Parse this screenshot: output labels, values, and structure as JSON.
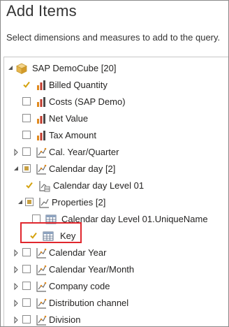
{
  "header": {
    "title": "Add Items",
    "subtitle": "Select dimensions and measures to add to the query."
  },
  "tree": {
    "root": {
      "label": "SAP DemoCube [20]"
    },
    "measures": [
      {
        "label": "Billed Quantity",
        "checked": true
      },
      {
        "label": "Costs (SAP Demo)",
        "checked": false
      },
      {
        "label": "Net Value",
        "checked": false
      },
      {
        "label": "Tax Amount",
        "checked": false
      }
    ],
    "dim_cal_year_quarter": {
      "label": "Cal. Year/Quarter"
    },
    "dim_calendar_day": {
      "label": "Calendar day [2]"
    },
    "level_calendar_day_01": {
      "label": "Calendar day Level 01"
    },
    "properties": {
      "label": "Properties [2]"
    },
    "prop_unique_name": {
      "label": "Calendar day Level 01.UniqueName"
    },
    "prop_key": {
      "label": "Key"
    },
    "dim_calendar_year": {
      "label": "Calendar Year"
    },
    "dim_calendar_year_month": {
      "label": "Calendar Year/Month"
    },
    "dim_company_code": {
      "label": "Company code"
    },
    "dim_distribution_channel": {
      "label": "Distribution channel"
    },
    "dim_division": {
      "label": "Division"
    }
  },
  "colors": {
    "check_fill": "#f2c811",
    "partial_fill": "#c8a042",
    "highlight_border": "#e0262d"
  }
}
